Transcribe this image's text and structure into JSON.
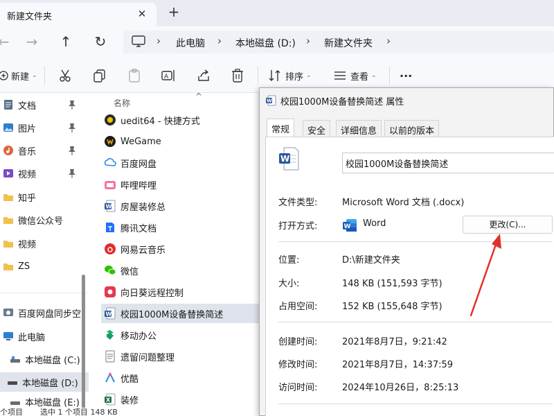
{
  "window": {
    "tab_title": "新建文件夹",
    "tab_close": "✕",
    "new_tab": "+"
  },
  "nav": {
    "back": "←",
    "forward": "→",
    "up": "↑",
    "refresh": "↻",
    "breadcrumbs": [
      "此电脑",
      "本地磁盘 (D:)",
      "新建文件夹"
    ],
    "crumb_separator": "›"
  },
  "toolbar": {
    "new_label": "新建",
    "sort_label": "排序",
    "view_label": "查看",
    "more": "···",
    "icons": [
      "cut-icon",
      "copy-icon",
      "paste-icon",
      "rename-icon",
      "share-icon",
      "delete-icon"
    ]
  },
  "sidebar": {
    "items": [
      {
        "label": "文档",
        "icon": "documents-icon",
        "pinned": true
      },
      {
        "label": "图片",
        "icon": "pictures-icon",
        "pinned": true
      },
      {
        "label": "音乐",
        "icon": "music-icon",
        "pinned": true
      },
      {
        "label": "视频",
        "icon": "videos-icon",
        "pinned": true
      },
      {
        "label": "知乎",
        "icon": "folder-icon",
        "pinned": false
      },
      {
        "label": "微信公众号",
        "icon": "folder-icon",
        "pinned": false
      },
      {
        "label": "视频",
        "icon": "folder-icon",
        "pinned": false
      },
      {
        "label": "ZS",
        "icon": "folder-icon",
        "pinned": false
      },
      {
        "label": "百度网盘同步空",
        "icon": "cloud-sync-icon",
        "pinned": false
      },
      {
        "label": "此电脑",
        "icon": "computer-icon",
        "pinned": false
      },
      {
        "label": "本地磁盘 (C:)",
        "icon": "drive-icon",
        "pinned": false
      },
      {
        "label": "本地磁盘 (D:)",
        "icon": "drive-icon",
        "pinned": false
      },
      {
        "label": "本地磁盘 (E:)",
        "icon": "drive-icon",
        "pinned": false
      }
    ],
    "active_index": 11
  },
  "filelist": {
    "column_header": "名称",
    "sort_indicator": "^",
    "files": [
      {
        "name": "uedit64 - 快捷方式",
        "icon": "uedit-icon"
      },
      {
        "name": "WeGame",
        "icon": "wegame-icon"
      },
      {
        "name": "百度网盘",
        "icon": "baidu-netdisk-icon"
      },
      {
        "name": "哔哩哔哩",
        "icon": "bilibili-icon"
      },
      {
        "name": "房屋装修总",
        "icon": "word-doc-icon"
      },
      {
        "name": "腾讯文档",
        "icon": "tencent-docs-icon"
      },
      {
        "name": "网易云音乐",
        "icon": "netease-music-icon"
      },
      {
        "name": "微信",
        "icon": "wechat-icon"
      },
      {
        "name": "向日葵远程控制",
        "icon": "sunlogin-icon"
      },
      {
        "name": "校园1000M设备替换简述",
        "icon": "word-doc-icon"
      },
      {
        "name": "移动办公",
        "icon": "mobile-office-icon"
      },
      {
        "name": "遗留问题整理",
        "icon": "text-file-icon"
      },
      {
        "name": "优酷",
        "icon": "youku-icon"
      },
      {
        "name": "装修",
        "icon": "excel-icon"
      }
    ],
    "selected_index": 9
  },
  "status": {
    "count": "个项目",
    "selection": "选中 1 个项目  148 KB"
  },
  "dialog": {
    "title": "校园1000M设备替换简述 属性",
    "tabs": [
      "常规",
      "安全",
      "详细信息",
      "以前的版本"
    ],
    "active_tab": 0,
    "file_name": "校园1000M设备替换简述",
    "rows": {
      "type_label": "文件类型:",
      "type_value": "Microsoft Word 文档 (.docx)",
      "open_label": "打开方式:",
      "open_value": "Word",
      "change_button": "更改(C)...",
      "location_label": "位置:",
      "location_value": "D:\\新建文件夹",
      "size_label": "大小:",
      "size_value": "148 KB (151,593 字节)",
      "disk_label": "占用空间:",
      "disk_value": "152 KB (155,648 字节)",
      "created_label": "创建时间:",
      "created_value": "2021年8月7日，9:21:42",
      "modified_label": "修改时间:",
      "modified_value": "2021年8月7日，14:37:59",
      "accessed_label": "访问时间:",
      "accessed_value": "2024年10月26日，8:25:13"
    }
  },
  "colors": {
    "accent_blue": "#2b579a",
    "annotation_red": "#e0302a",
    "selection_bg": "#dfe4ec"
  }
}
